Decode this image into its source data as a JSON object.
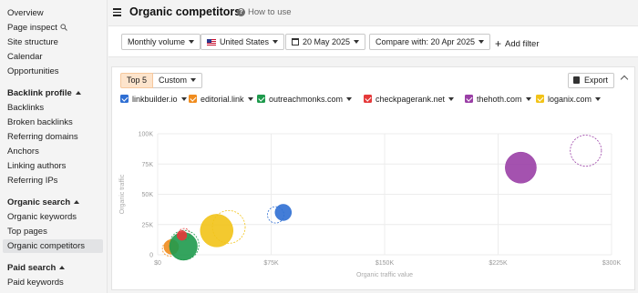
{
  "sidebar": {
    "items": [
      {
        "label": "Overview",
        "type": "item"
      },
      {
        "label": "Page inspect",
        "type": "item",
        "icon": "search-icon"
      },
      {
        "label": "Site structure",
        "type": "item"
      },
      {
        "label": "Calendar",
        "type": "item"
      },
      {
        "label": "Opportunities",
        "type": "item"
      },
      {
        "label": "Backlink profile",
        "type": "head"
      },
      {
        "label": "Backlinks",
        "type": "item"
      },
      {
        "label": "Broken backlinks",
        "type": "item"
      },
      {
        "label": "Referring domains",
        "type": "item"
      },
      {
        "label": "Anchors",
        "type": "item"
      },
      {
        "label": "Linking authors",
        "type": "item"
      },
      {
        "label": "Referring IPs",
        "type": "item"
      },
      {
        "label": "Organic search",
        "type": "head"
      },
      {
        "label": "Organic keywords",
        "type": "item"
      },
      {
        "label": "Top pages",
        "type": "item"
      },
      {
        "label": "Organic competitors",
        "type": "item",
        "active": true
      },
      {
        "label": "Paid search",
        "type": "head"
      },
      {
        "label": "Paid keywords",
        "type": "item"
      }
    ]
  },
  "header": {
    "title": "Organic competitors",
    "help": "How to use"
  },
  "filters": {
    "volume": "Monthly volume",
    "country": "United States",
    "date": "20 May 2025",
    "compare": "Compare with: 20 Apr 2025",
    "add": "Add filter"
  },
  "card": {
    "top5": "Top 5",
    "custom": "Custom",
    "export": "Export"
  },
  "legend": [
    {
      "label": "linkbuilder.io",
      "color": "#2f6fd3"
    },
    {
      "label": "editorial.link",
      "color": "#f08c1e"
    },
    {
      "label": "outreachmonks.com",
      "color": "#1e9a4c"
    },
    {
      "label": "checkpagerank.net",
      "color": "#e5393a"
    },
    {
      "label": "thehoth.com",
      "color": "#9a3fa6"
    },
    {
      "label": "loganix.com",
      "color": "#f2c318"
    }
  ],
  "chart_data": {
    "type": "scatter",
    "xlabel": "Organic traffic value",
    "ylabel": "Organic traffic",
    "xlim": [
      0,
      300000
    ],
    "ylim": [
      0,
      100000
    ],
    "x_ticks": [
      "$0",
      "$75K",
      "$150K",
      "$225K",
      "$300K"
    ],
    "y_ticks": [
      "0",
      "25K",
      "50K",
      "75K",
      "100K"
    ],
    "grid": true,
    "series": [
      {
        "name": "linkbuilder.io",
        "color": "#2f6fd3",
        "current": {
          "x": 83000,
          "y": 35000,
          "size": 1
        },
        "previous": {
          "x": 78000,
          "y": 33000,
          "size": 1
        }
      },
      {
        "name": "editorial.link",
        "color": "#f08c1e",
        "current": {
          "x": 9000,
          "y": 6500,
          "size": 0.9
        },
        "previous": {
          "x": 8000,
          "y": 5000,
          "size": 0.9
        }
      },
      {
        "name": "outreachmonks.com",
        "color": "#1e9a4c",
        "current": {
          "x": 17000,
          "y": 7000,
          "size": 1.7
        },
        "previous": {
          "x": 17500,
          "y": 8000,
          "size": 1.8
        }
      },
      {
        "name": "checkpagerank.net",
        "color": "#e5393a",
        "current": {
          "x": 16000,
          "y": 16000,
          "size": 0.6
        },
        "previous": {
          "x": 17500,
          "y": 17000,
          "size": 0.7
        }
      },
      {
        "name": "thehoth.com",
        "color": "#9a3fa6",
        "current": {
          "x": 240000,
          "y": 72000,
          "size": 1.9
        },
        "previous": {
          "x": 283000,
          "y": 86000,
          "size": 1.9
        }
      },
      {
        "name": "loganix.com",
        "color": "#f2c318",
        "current": {
          "x": 39000,
          "y": 20000,
          "size": 2.0
        },
        "previous": {
          "x": 47000,
          "y": 23000,
          "size": 2.0
        }
      }
    ]
  }
}
